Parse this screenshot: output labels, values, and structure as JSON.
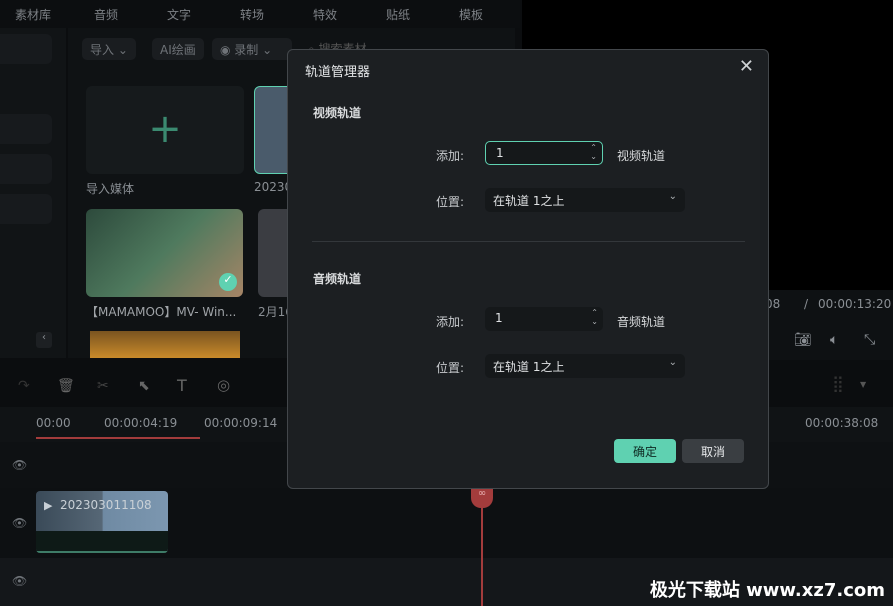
{
  "top_tabs": [
    "素材库",
    "音频",
    "文字",
    "转场",
    "特效",
    "贴纸",
    "模板"
  ],
  "media_toolbar": {
    "import": "导入",
    "ai": "AI绘画",
    "record": "录制",
    "search_placeholder": "搜索素材"
  },
  "media_items": [
    {
      "label": "导入媒体"
    },
    {
      "label": "20230"
    },
    {
      "label": "【MAMAMOO】MV- Win..."
    },
    {
      "label": "2月16"
    }
  ],
  "preview": {
    "current_time": "08",
    "separator": "/",
    "total_time": "00:00:13:20"
  },
  "ruler": [
    "00:00",
    "00:00:04:19",
    "00:00:09:14",
    "00:00:38:08"
  ],
  "clip": {
    "name": "202303011108"
  },
  "dialog": {
    "title": "轨道管理器",
    "video": {
      "section": "视频轨道",
      "add_label": "添加:",
      "add_value": "1",
      "unit": "视频轨道",
      "pos_label": "位置:",
      "pos_value": "在轨道 1之上"
    },
    "audio": {
      "section": "音频轨道",
      "add_label": "添加:",
      "add_value": "1",
      "unit": "音频轨道",
      "pos_label": "位置:",
      "pos_value": "在轨道 1之上"
    },
    "ok": "确定",
    "cancel": "取消"
  },
  "accent": "#5fd1b1",
  "watermark": "极光下载站 www.xz7.com"
}
